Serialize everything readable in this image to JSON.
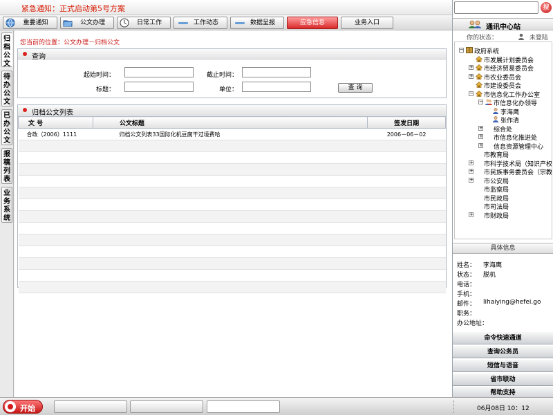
{
  "banner": {
    "notice": "紧急通知：正式启动第5号方案"
  },
  "nav": {
    "tabs": [
      {
        "label": "重要通知",
        "icon": "globe-icon"
      },
      {
        "label": "公文办理",
        "icon": "folder-icon"
      },
      {
        "label": "日常工作",
        "icon": "clock-icon"
      },
      {
        "label": "工作动态",
        "icon": "bar-icon"
      },
      {
        "label": "数据呈报",
        "icon": "bar-icon"
      },
      {
        "label": "应急信息",
        "icon": "alert"
      },
      {
        "label": "业务入口",
        "icon": "none"
      }
    ],
    "active": "应急信息"
  },
  "left_tabs": [
    {
      "label": "归档公文",
      "active": true
    },
    {
      "label": "待办公文",
      "active": false
    },
    {
      "label": "已办公文",
      "active": false
    },
    {
      "label": "报稿列表",
      "active": false
    },
    {
      "label": "业务系统",
      "active": false
    }
  ],
  "breadcrumb": "您当前的位置：公文办理－归档公文",
  "query": {
    "title": "查询",
    "start_label": "起始时间：",
    "end_label": "截止时间：",
    "subject_label": "标题：",
    "unit_label": "单位：",
    "start_value": "",
    "end_value": "",
    "subject_value": "",
    "unit_value": "",
    "button": "查  询"
  },
  "archive": {
    "title": "归档公文列表",
    "columns": [
      "文  号",
      "公文标题",
      "签发日期"
    ],
    "rows": [
      {
        "number": "合政（2006）1111",
        "subject": "归档公文列表33国际化机豆腐干过境费哈",
        "date": "2006－06－02"
      }
    ]
  },
  "sidebar": {
    "search_value": "",
    "search_button": "搜",
    "title": "通讯中心站",
    "status_label": "你的状态：",
    "status_value": "未登陆",
    "tree": [
      {
        "label": "政府系统",
        "level": 0,
        "expander": "−",
        "icon": "book"
      },
      {
        "label": "市发展计划委员会",
        "level": 1,
        "expander": "",
        "icon": "house"
      },
      {
        "label": "市经济贸易委员会",
        "level": 1,
        "expander": "+",
        "icon": "house"
      },
      {
        "label": "市农业委员会",
        "level": 1,
        "expander": "+",
        "icon": "house"
      },
      {
        "label": "市建设委员会",
        "level": 1,
        "expander": "",
        "icon": "house"
      },
      {
        "label": "市信息化工作办公室",
        "level": 1,
        "expander": "−",
        "icon": "house"
      },
      {
        "label": "市信息化办领导",
        "level": 2,
        "expander": "−",
        "icon": "group"
      },
      {
        "label": "李海鹰",
        "level": 3,
        "expander": "",
        "icon": "person"
      },
      {
        "label": "张作清",
        "level": 3,
        "expander": "",
        "icon": "person"
      },
      {
        "label": "综合处",
        "level": 2,
        "expander": "+",
        "icon": ""
      },
      {
        "label": "市信息化推进处",
        "level": 2,
        "expander": "+",
        "icon": ""
      },
      {
        "label": "信息资源管理中心",
        "level": 2,
        "expander": "+",
        "icon": ""
      },
      {
        "label": "市教育局",
        "level": 1,
        "expander": "",
        "icon": ""
      },
      {
        "label": "市科学技术局（知识产权局）",
        "level": 1,
        "expander": "+",
        "icon": ""
      },
      {
        "label": "市民族事务委员会（宗教局）",
        "level": 1,
        "expander": "+",
        "icon": ""
      },
      {
        "label": "市公安局",
        "level": 1,
        "expander": "+",
        "icon": ""
      },
      {
        "label": "市监察局",
        "level": 1,
        "expander": "",
        "icon": ""
      },
      {
        "label": "市民政局",
        "level": 1,
        "expander": "",
        "icon": ""
      },
      {
        "label": "市司法局",
        "level": 1,
        "expander": "",
        "icon": ""
      },
      {
        "label": "市财政局",
        "level": 1,
        "expander": "+",
        "icon": ""
      }
    ],
    "detail_title": "具体信息",
    "details": [
      {
        "label": "姓名：",
        "value": "李海鹰"
      },
      {
        "label": "状态：",
        "value": "脱机"
      },
      {
        "label": "电话：",
        "value": ""
      },
      {
        "label": "手机：",
        "value": ""
      },
      {
        "label": "邮件：",
        "value": "lihaiying@hefei.go"
      },
      {
        "label": "职务：",
        "value": ""
      },
      {
        "label": "办公地址：",
        "value": ""
      }
    ],
    "buttons": [
      "命令快速通道",
      "查询公务员",
      "短信与语音",
      "省市联动",
      "帮助支持"
    ]
  },
  "taskbar": {
    "start_label": "开始",
    "slots": 3,
    "active_slot": 2,
    "clock": "06月08日  10：12"
  },
  "colors": {
    "accent_red": "#d81e06",
    "active_tab": "#d92a2a",
    "border": "#aeb7c3"
  }
}
